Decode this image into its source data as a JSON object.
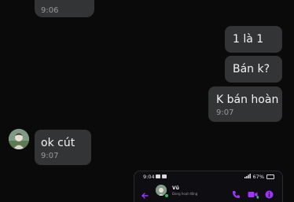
{
  "messages": [
    {
      "id": "top",
      "side": "received",
      "text": "",
      "time": "9:06"
    },
    {
      "id": "one",
      "side": "sent",
      "text": "1 là 1",
      "time": ""
    },
    {
      "id": "bank",
      "side": "sent",
      "text": "Bán k?",
      "time": ""
    },
    {
      "id": "kban",
      "side": "sent",
      "text": "K bán hoàn",
      "time": "9:07"
    },
    {
      "id": "ok",
      "side": "received",
      "text": "ok cút",
      "time": "9:07"
    }
  ],
  "attachment": {
    "status_time": "9:04",
    "battery": "67%",
    "contact_name": "Vũ",
    "contact_status": "Đang hoạt động",
    "accent_color": "#a033ff"
  },
  "colors": {
    "background": "#0a0a0a",
    "bubble": "#333436",
    "online": "#31c24d"
  },
  "icons": [
    "avatar",
    "back-arrow-icon",
    "phone-icon",
    "video-camera-icon",
    "info-icon"
  ]
}
